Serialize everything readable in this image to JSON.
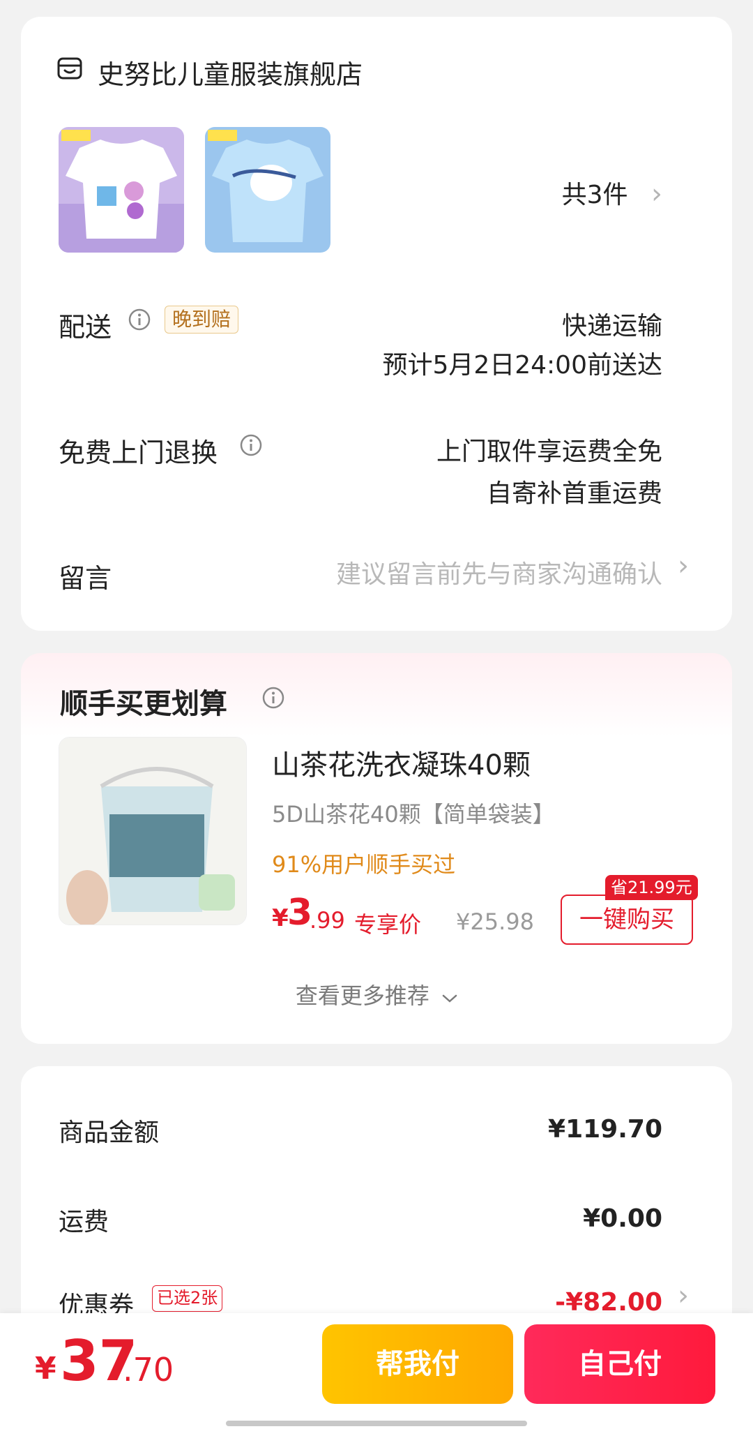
{
  "shop": {
    "name": "史努比儿童服装旗舰店",
    "item_count": "共3件"
  },
  "delivery": {
    "label": "配送",
    "badge": "晚到赔",
    "method": "快递运输",
    "eta": "预计5月2日24:00前送达"
  },
  "returns": {
    "label": "免费上门退换",
    "line1": "上门取件享运费全免",
    "line2": "自寄补首重运费"
  },
  "message": {
    "label": "留言",
    "placeholder": "建议留言前先与商家沟通确认"
  },
  "upsell": {
    "title": "顺手买更划算",
    "product_name": "山茶花洗衣凝珠40颗",
    "spec": "5D山茶花40颗【简单袋装】",
    "stat": "91%用户顺手买过",
    "price_symbol": "¥",
    "price_int": "3",
    "price_dec": ".99",
    "price_tag": "专享价",
    "original_price": "¥25.98",
    "save_badge": "省21.99元",
    "buy_button": "一键购买",
    "more": "查看更多推荐"
  },
  "summary": {
    "goods_label": "商品金额",
    "goods_value": "¥119.70",
    "shipping_label": "运费",
    "shipping_value": "¥0.00",
    "coupon_label": "优惠券",
    "coupon_badge": "已选2张",
    "coupon_value": "-¥82.00"
  },
  "footer": {
    "total_symbol": "¥",
    "total_int": "37",
    "total_dec": ".70",
    "help_pay": "帮我付",
    "self_pay": "自己付"
  },
  "colors": {
    "accent_red": "#e41c2c",
    "help_yellow": "#ffb800",
    "self_red": "#ff2448"
  }
}
